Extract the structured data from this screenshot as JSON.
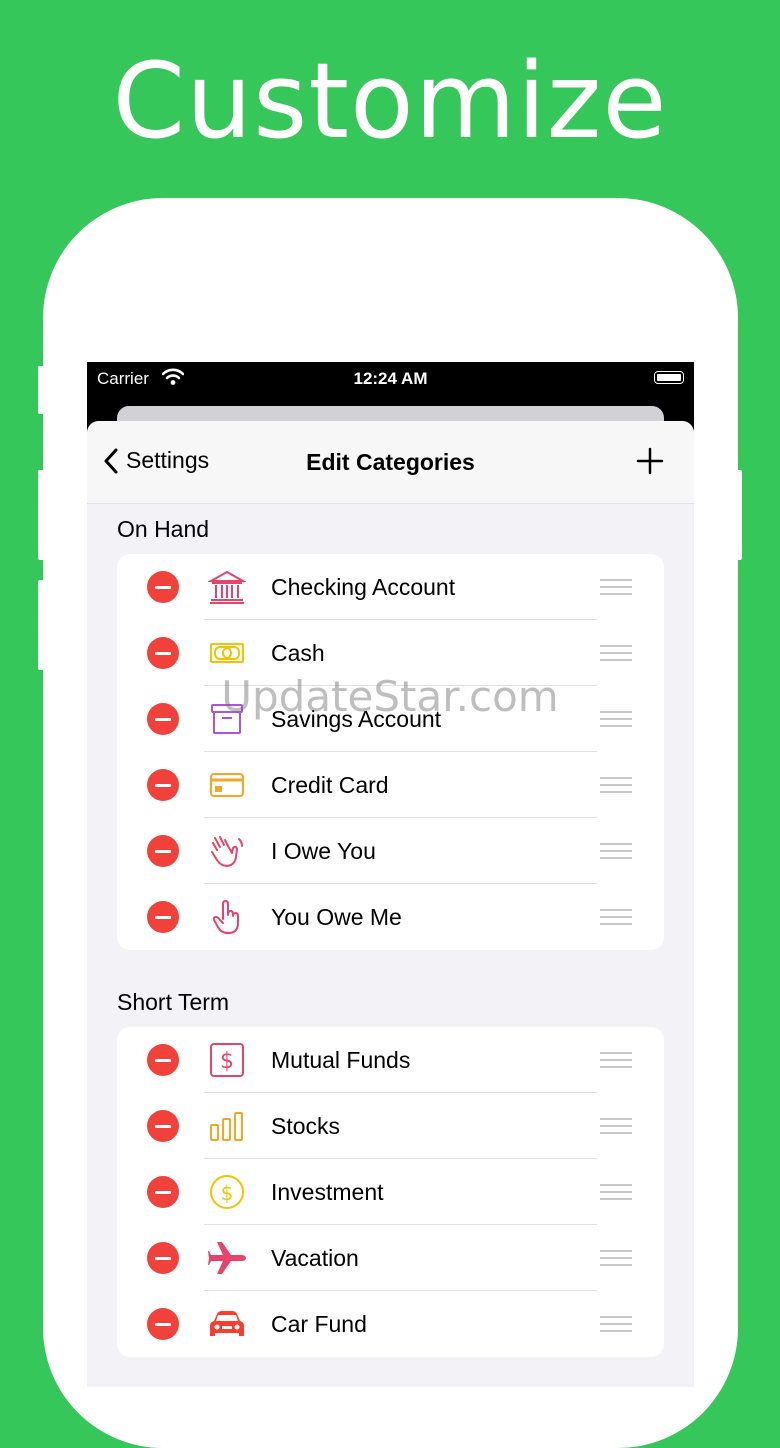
{
  "headline": "Customize",
  "status": {
    "carrier": "Carrier",
    "time": "12:24 AM"
  },
  "nav": {
    "back_label": "Settings",
    "title": "Edit Categories"
  },
  "sections": [
    {
      "header": "On Hand",
      "items": [
        {
          "label": "Checking Account",
          "icon": "bank-icon",
          "color": "#E8446B"
        },
        {
          "label": "Cash",
          "icon": "banknote-icon",
          "color": "#F2C500"
        },
        {
          "label": "Savings Account",
          "icon": "archive-box-icon",
          "color": "#AF52DE"
        },
        {
          "label": "Credit Card",
          "icon": "credit-card-icon",
          "color": "#F5A623"
        },
        {
          "label": "I Owe You",
          "icon": "waving-hand-icon",
          "color": "#E8446B"
        },
        {
          "label": "You Owe Me",
          "icon": "pointing-hand-icon",
          "color": "#E8446B"
        }
      ]
    },
    {
      "header": "Short Term",
      "items": [
        {
          "label": "Mutual Funds",
          "icon": "dollar-square-icon",
          "color": "#E8446B"
        },
        {
          "label": "Stocks",
          "icon": "bar-chart-icon",
          "color": "#F5A623"
        },
        {
          "label": "Investment",
          "icon": "dollar-coin-icon",
          "color": "#F2C500"
        },
        {
          "label": "Vacation",
          "icon": "airplane-icon",
          "color": "#E8446B"
        },
        {
          "label": "Car Fund",
          "icon": "car-icon",
          "color": "#FF3B30"
        }
      ]
    }
  ],
  "watermark": "UpdateStar.com",
  "colors": {
    "background": "#35C759",
    "delete": "#F0413A"
  }
}
